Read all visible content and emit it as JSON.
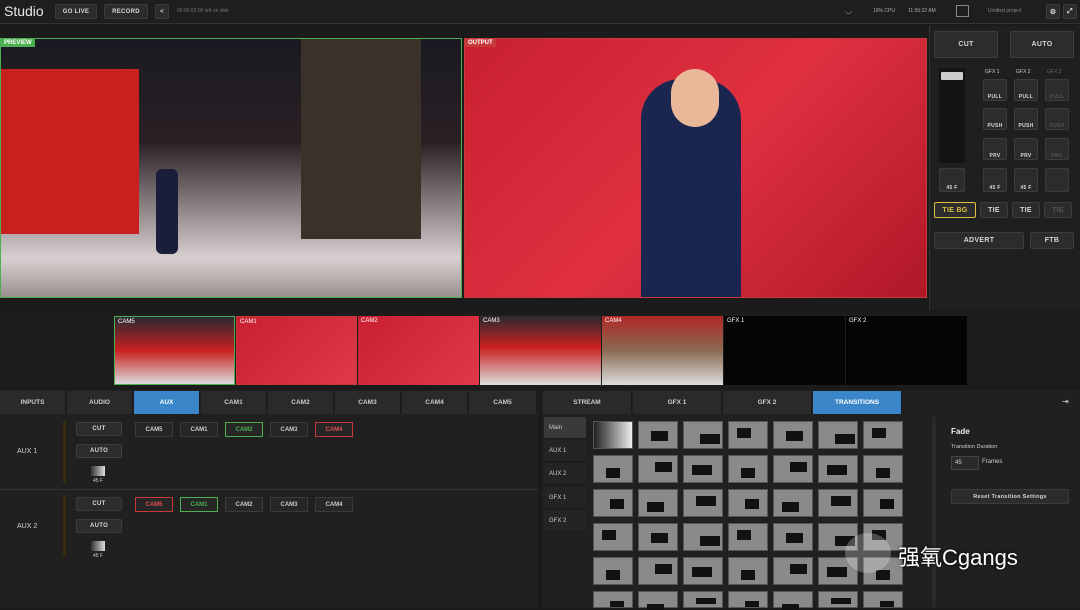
{
  "app": {
    "title": "Studio",
    "go_live": "GO LIVE",
    "record": "RECORD",
    "status": "00:00:52:00 left on disk",
    "cpu": "19% CPU",
    "clock": "11:55:32 AM",
    "project": "Untitled project"
  },
  "preview": {
    "label": "PREVIEW"
  },
  "output": {
    "label": "OUTPUT"
  },
  "transition_bar": {
    "cut": "CUT",
    "auto": "AUTO",
    "frames": "45 F"
  },
  "gfx": {
    "headers": [
      "GFX 1",
      "GFX 2",
      "GFX 3"
    ],
    "pull": "PULL",
    "push": "PUSH",
    "prv": "PRV",
    "frames": "45 F",
    "tie_bg": "TIE BG",
    "tie": "TIE",
    "advert": "ADVERT",
    "ftb": "FTB"
  },
  "multiview": [
    "CAM5",
    "CAM1",
    "CAM2",
    "CAM3",
    "CAM4",
    "GFX 1",
    "GFX 2"
  ],
  "bottom_tabs": [
    "INPUTS",
    "AUDIO",
    "AUX",
    "CAM1",
    "CAM2",
    "CAM3",
    "CAM4",
    "CAM5"
  ],
  "right_tabs": [
    "STREAM",
    "GFX 1",
    "GFX 2",
    "TRANSITIONS"
  ],
  "aux1": {
    "label": "AUX 1",
    "cut": "CUT",
    "auto": "AUTO",
    "frames": "45 F",
    "sources": [
      "CAM5",
      "CAM1",
      "CAM2",
      "CAM3",
      "CAM4"
    ]
  },
  "aux2": {
    "label": "AUX 2",
    "cut": "CUT",
    "auto": "AUTO",
    "frames": "45 F",
    "sources": [
      "CAM5",
      "CAM1",
      "CAM2",
      "CAM3",
      "CAM4"
    ]
  },
  "trans_side": [
    "Main",
    "AUX 1",
    "AUX 2",
    "GFX 1",
    "GFX 2"
  ],
  "fade": {
    "title": "Fade",
    "duration_label": "Transition Duration",
    "value": "45",
    "unit": "Frames",
    "reset": "Reset Transition Settings"
  },
  "watermark": "强氧Cgangs",
  "colors": {
    "accent": "#3a86c8",
    "live": "#c83a3a",
    "preview": "#4caf50"
  }
}
